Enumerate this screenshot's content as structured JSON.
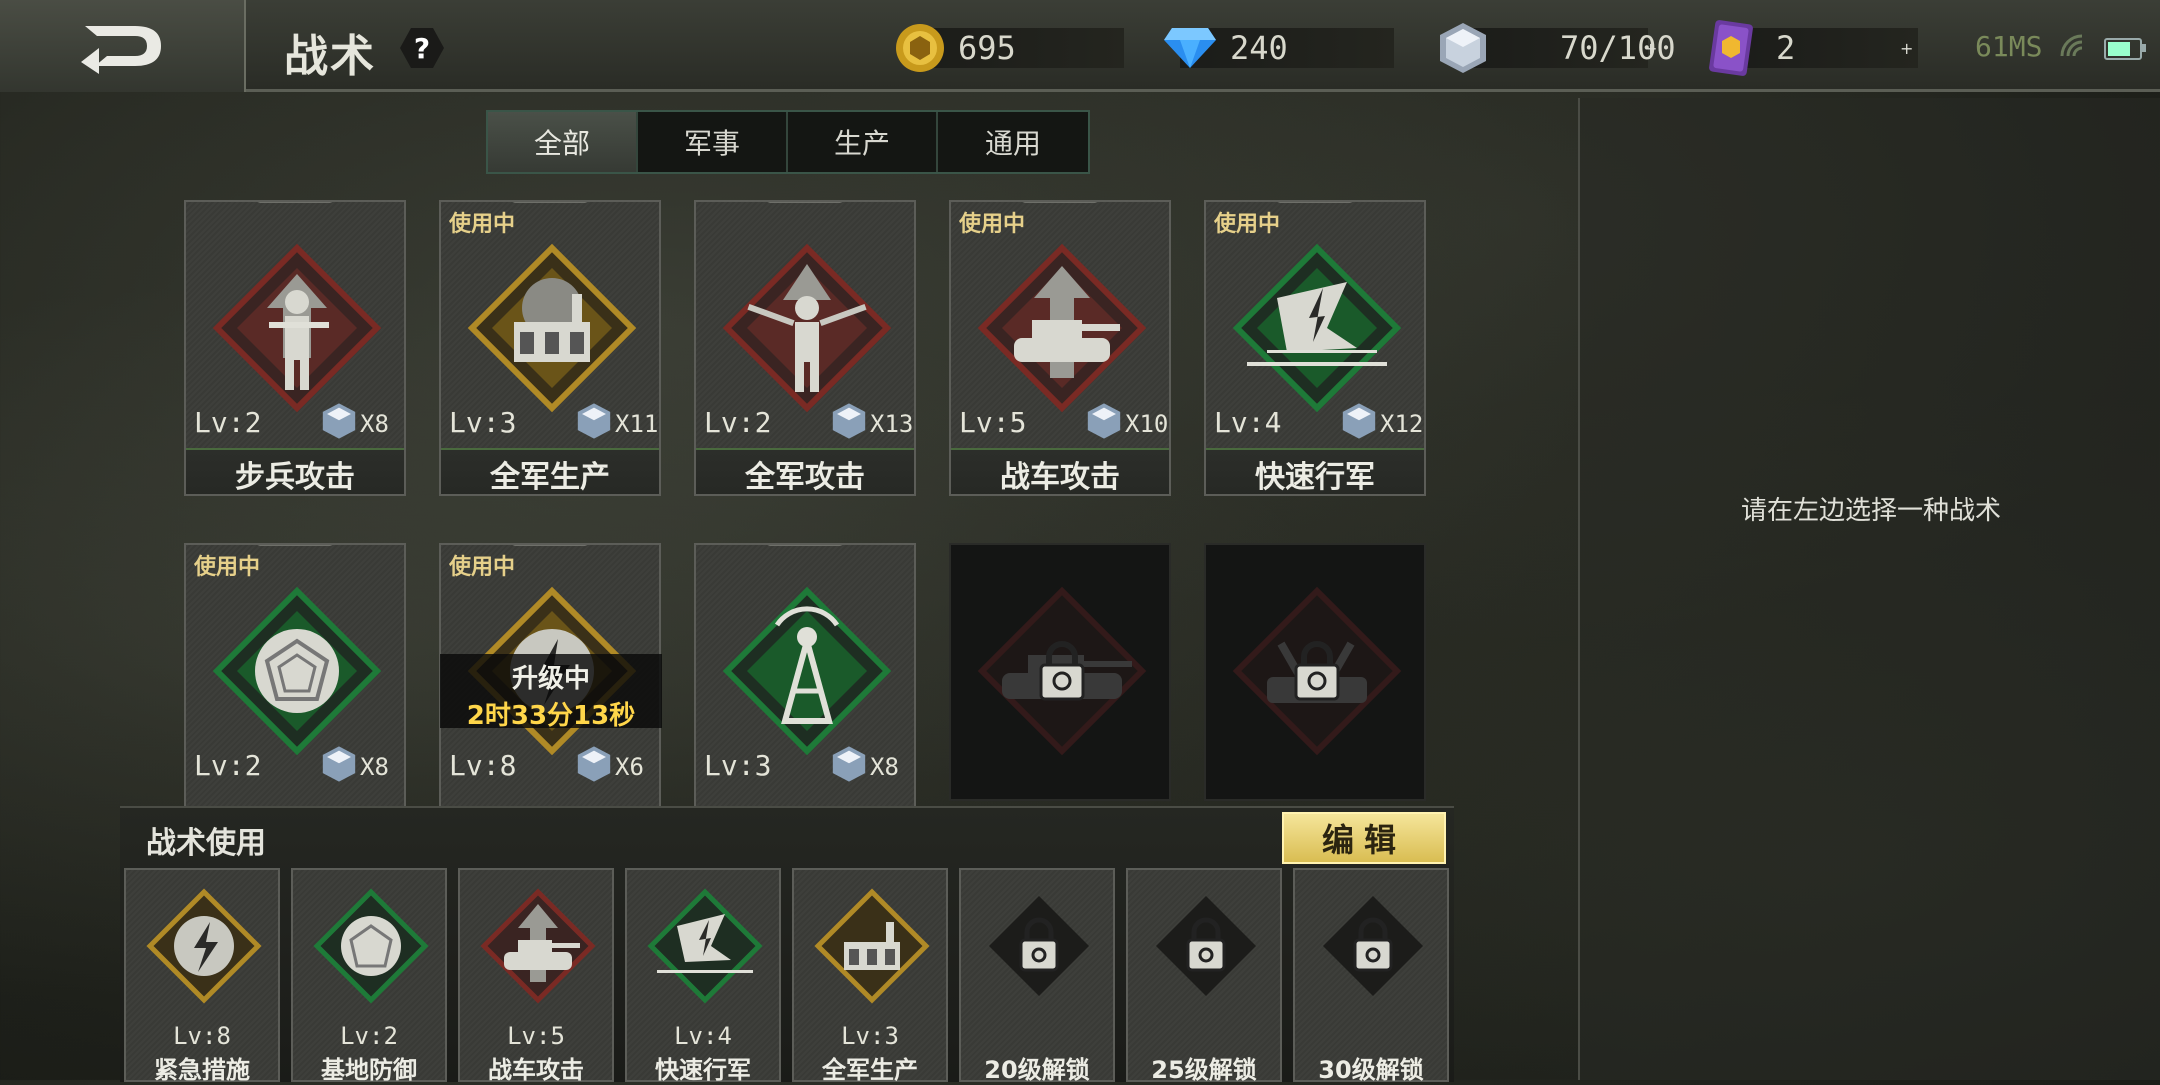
{
  "header": {
    "title": "战术",
    "help": "?",
    "gold": "695",
    "diamond": "240",
    "crystal": "70/100",
    "card_count": "2",
    "ping": "61MS"
  },
  "tabs": [
    "全部",
    "军事",
    "生产",
    "通用"
  ],
  "cards": [
    {
      "in_use": "",
      "lv": "Lv:2",
      "count": "X8",
      "name": "步兵攻击",
      "color": "#7a2a24"
    },
    {
      "in_use": "使用中",
      "lv": "Lv:3",
      "count": "X11",
      "name": "全军生产",
      "color": "#8a6a1c"
    },
    {
      "in_use": "",
      "lv": "Lv:2",
      "count": "X13",
      "name": "全军攻击",
      "color": "#7a2a24"
    },
    {
      "in_use": "使用中",
      "lv": "Lv:5",
      "count": "X10",
      "name": "战车攻击",
      "color": "#7a2a24"
    },
    {
      "in_use": "使用中",
      "lv": "Lv:4",
      "count": "X12",
      "name": "快速行军",
      "color": "#1e6a32"
    },
    {
      "in_use": "使用中",
      "lv": "Lv:2",
      "count": "X8",
      "color": "#1e6a32"
    },
    {
      "in_use": "使用中",
      "lv": "Lv:8",
      "count": "X6",
      "color": "#8a6a1c"
    },
    {
      "in_use": "",
      "lv": "Lv:3",
      "count": "X8",
      "color": "#1e6a32"
    }
  ],
  "upgrade": {
    "label": "升级中",
    "time": "2时33分13秒"
  },
  "bottom": {
    "title": "战术使用",
    "edit": "编辑",
    "slots": [
      {
        "lv": "Lv:8",
        "name": "紧急措施",
        "color": "#8a6a1c"
      },
      {
        "lv": "Lv:2",
        "name": "基地防御",
        "color": "#1e6a32"
      },
      {
        "lv": "Lv:5",
        "name": "战车攻击",
        "color": "#7a2a24"
      },
      {
        "lv": "Lv:4",
        "name": "快速行军",
        "color": "#1e6a32"
      },
      {
        "lv": "Lv:3",
        "name": "全军生产",
        "color": "#8a6a1c"
      },
      {
        "lv": "",
        "name": "20级解锁"
      },
      {
        "lv": "",
        "name": "25级解锁"
      },
      {
        "lv": "",
        "name": "30级解锁"
      }
    ]
  },
  "right_panel": {
    "hint": "请在左边选择一种战术"
  }
}
